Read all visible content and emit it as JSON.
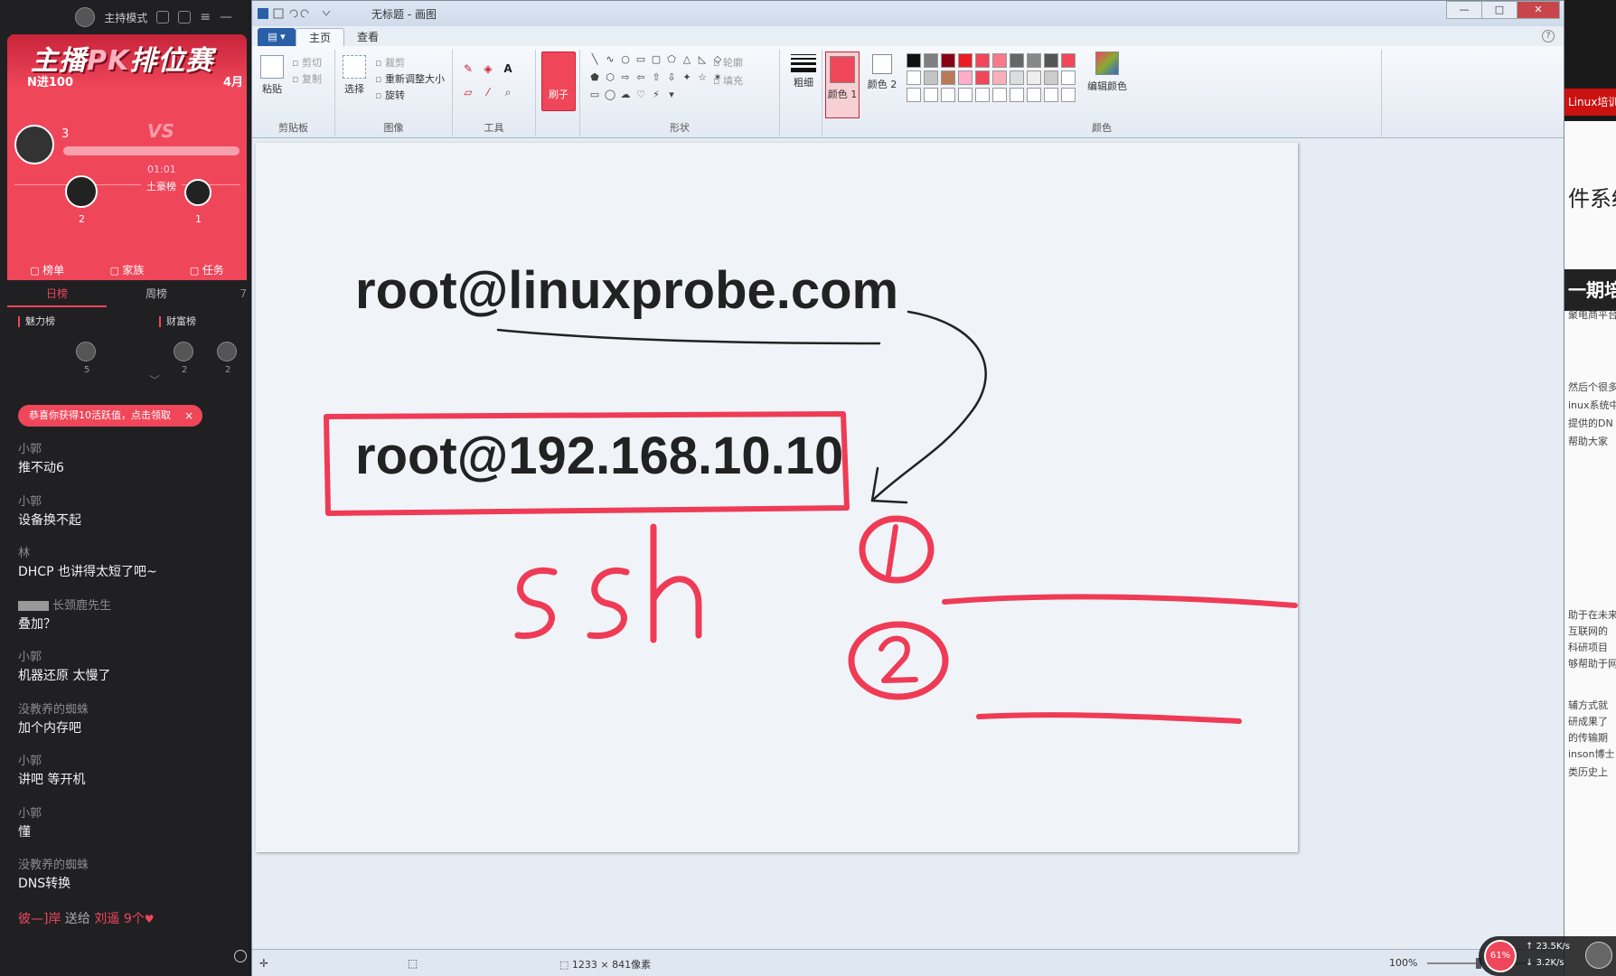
{
  "live": {
    "topbar": {
      "mode_label": "主持模式"
    },
    "pk": {
      "title_a": "主播",
      "title_pk": "PK",
      "title_b": "排位赛",
      "stage": "N进100",
      "stage_right": "4月",
      "anchor_count": "3",
      "vs": "VS",
      "timer": "01:01",
      "rank_label": "土豪榜",
      "fan_left_num": "2",
      "fan_right_num": "1",
      "tabs": [
        "榜单",
        "家族",
        "任务"
      ]
    },
    "rank_tabs": {
      "daily": "日榜",
      "weekly": "周榜",
      "extra": "7"
    },
    "boards": {
      "charm": "魅力榜",
      "wealth": "财富榜",
      "charm_num": "5",
      "wealth_num_1": "2",
      "wealth_num_2": "2"
    },
    "promo": {
      "text": "恭喜你获得10活跃值，点击领取",
      "close": "×"
    },
    "chat": [
      {
        "user": "小郭",
        "text": "推不动6"
      },
      {
        "user": "小郭",
        "text": "设备换不起"
      },
      {
        "user": "林",
        "text": "DHCP 也讲得太短了吧~"
      },
      {
        "user": "长颈鹿先生",
        "text": "叠加？",
        "badge": true
      },
      {
        "user": "小郭",
        "text": "机器还原 太慢了"
      },
      {
        "user": "没教养的蜘蛛",
        "text": "加个内存吧"
      },
      {
        "user": "小郭",
        "text": "讲吧 等开机"
      },
      {
        "user": "小郭",
        "text": "懂"
      },
      {
        "user": "没教养的蜘蛛",
        "text": "DNS转换"
      }
    ],
    "gift": {
      "from": "彼—]岸",
      "verb": "送给",
      "to": "刘遥",
      "count": "9个"
    }
  },
  "paint": {
    "title": "无标题 - 画图",
    "menu": {
      "file": "▤ ▾",
      "home": "主页",
      "view": "查看"
    },
    "window_buttons": {
      "min": "—",
      "max": "□",
      "close": "✕"
    },
    "clipboard": {
      "paste": "粘贴",
      "cut": "剪切",
      "copy": "复制",
      "label": "剪贴板"
    },
    "image": {
      "select": "选择",
      "crop": "裁剪",
      "resize": "重新调整大小",
      "rotate": "旋转",
      "label": "图像"
    },
    "tools": {
      "label": "工具",
      "text_tool": "A"
    },
    "brush": {
      "label": "刷子"
    },
    "shapes": {
      "outline": "轮廓",
      "fill": "填充",
      "label": "形状"
    },
    "size": {
      "label": "粗细"
    },
    "colors": {
      "color1": "颜色 1",
      "color2": "颜色 2",
      "edit": "编辑颜色",
      "label": "颜色"
    },
    "palette": [
      "#111111",
      "#7f7f7f",
      "#880015",
      "#ed1c24",
      "#f0465a",
      "#f77a8a",
      "#666666",
      "#888888",
      "#555555",
      "#f0465a",
      "#ffffff",
      "#c3c3c3",
      "#b97a57",
      "#ffaec9",
      "#f0465a",
      "#f8b0bb",
      "#dddddd",
      "#eeeeee",
      "#cccccc",
      "#ffffff",
      "#ffffff",
      "#ffffff",
      "#ffffff",
      "#ffffff",
      "#ffffff",
      "#ffffff",
      "#ffffff",
      "#ffffff",
      "#ffffff",
      "#ffffff"
    ],
    "canvas": {
      "line1": "root@linuxprobe.com",
      "line2": "root@192.168.10.10",
      "handwriting": "ssh",
      "circle_1": "1",
      "circle_2": "2",
      "ink_red": "#ef3b55",
      "ink_dark": "#222222"
    },
    "status": {
      "image_size": "1233 × 841像素",
      "zoom": "100%"
    }
  },
  "background_window": {
    "tab": "Linux培训",
    "heading": "件系统",
    "banner": "一期培",
    "lines": [
      "聚电商平台",
      "然后个很多",
      "inux系统中",
      "提供的DN",
      "帮助大家",
      "助于在未来",
      "互联网的",
      "科研项目",
      "够帮助于网",
      "辅方式就",
      "研成果了",
      "的传输期",
      "inson博士",
      "类历史上"
    ]
  },
  "net_widget": {
    "percent": "61%",
    "up": "23.5K/s",
    "down": "3.2K/s"
  }
}
